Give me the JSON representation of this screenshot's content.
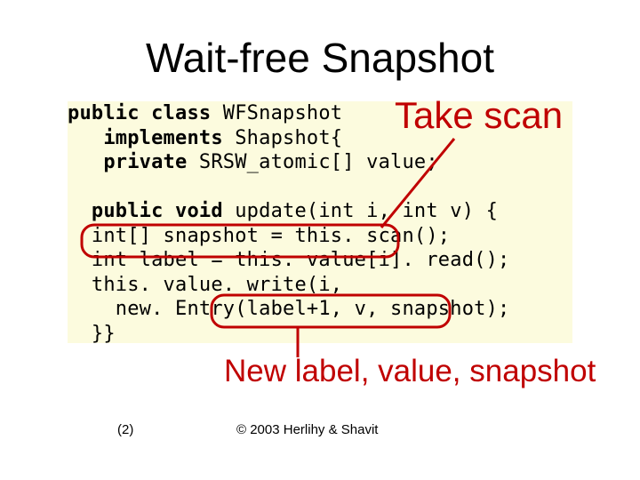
{
  "title": "Wait-free Snapshot",
  "code": {
    "l1a": "public class ",
    "l1b": "WFSnapshot",
    "l2a": "   implements ",
    "l2b": "Shapshot{",
    "l3a": "   private ",
    "l3b": "SRSW_atomic[] value;",
    "l4": "",
    "l5a": "  public void ",
    "l5b": "update(int i, int v) {",
    "l6a": "  int[] snapshot = this. scan();",
    "l7a": "  int label = this. value[i]. read();",
    "l8a": "  this. value. write(i,",
    "l9a": "    new. Entry(label+1, v, snapshot);",
    "l10a": "  }}"
  },
  "annotations": {
    "take_scan": "Take scan",
    "new_label": "New label, value, snapshot"
  },
  "footer": {
    "num": "(2)",
    "copy": "© 2003 Herlihy & Shavit"
  }
}
